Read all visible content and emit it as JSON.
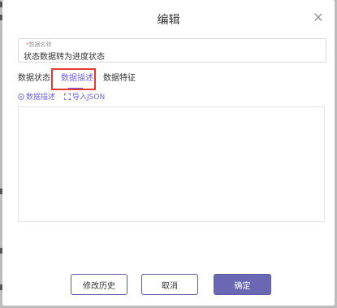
{
  "modal": {
    "title": "编辑",
    "close_icon": "close-icon"
  },
  "field": {
    "required_mark": "*",
    "label": "数据名称",
    "value": "状态数据转为进度状态"
  },
  "tabs": [
    {
      "label": "数据状态"
    },
    {
      "label": "数据描述",
      "active": true
    },
    {
      "label": "数据特征"
    }
  ],
  "subbar": {
    "describe_label": "数据描述",
    "import_label": "导入JSON"
  },
  "description": {
    "value": ""
  },
  "footer": {
    "history_label": "修改历史",
    "cancel_label": "取消",
    "confirm_label": "确定"
  },
  "colors": {
    "accent": "#6c63ff",
    "primary_button": "#6b68b3",
    "highlight_border": "#e53935"
  }
}
